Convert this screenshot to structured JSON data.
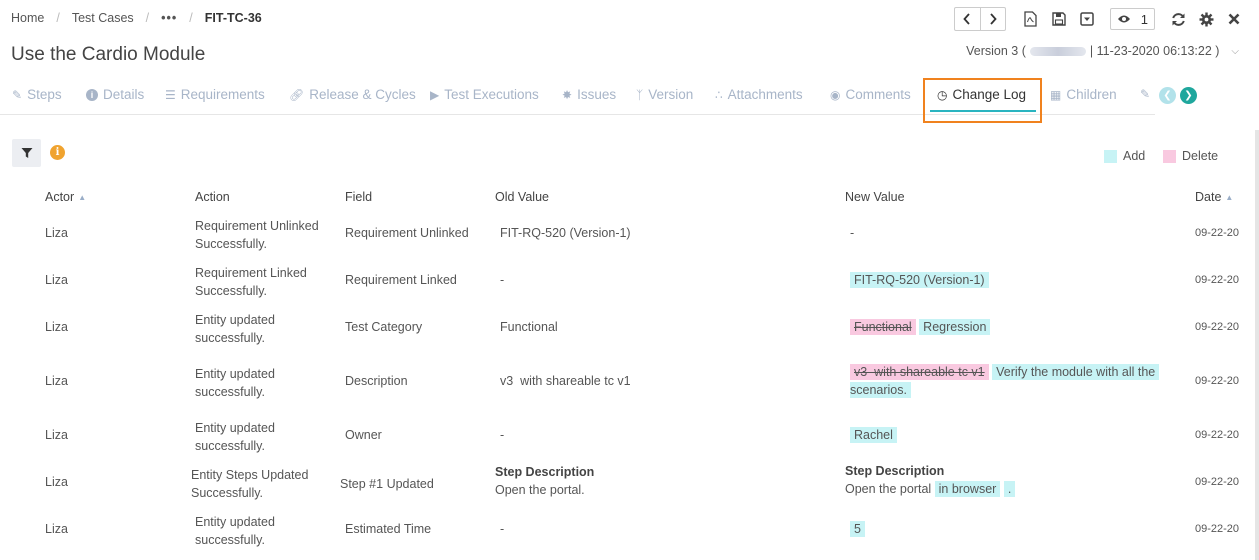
{
  "breadcrumb": {
    "home": "Home",
    "test_cases": "Test Cases",
    "more": "•••",
    "current": "FIT-TC-36"
  },
  "title": "Use the Cardio Module",
  "toolbar": {
    "watch_count": "1"
  },
  "version": {
    "prefix": "Version 3 (",
    "suffix": "| 11-23-2020 06:13:22 )"
  },
  "tabs": [
    {
      "label": "Steps",
      "icon": "edit-icon"
    },
    {
      "label": "Details",
      "icon": "info-icon"
    },
    {
      "label": "Requirements",
      "icon": "list-icon"
    },
    {
      "label": "Release & Cycles",
      "icon": "link-icon"
    },
    {
      "label": "Test Executions",
      "icon": "play-icon"
    },
    {
      "label": "Issues",
      "icon": "bug-icon"
    },
    {
      "label": "Version",
      "icon": "branch-icon"
    },
    {
      "label": "Attachments",
      "icon": "paperclip-icon"
    },
    {
      "label": "Comments",
      "icon": "comments-icon"
    },
    {
      "label": "Change Log",
      "icon": "clock-icon"
    },
    {
      "label": "Children",
      "icon": "sitemap-icon"
    }
  ],
  "colors": {
    "accent": "#2ab4c0",
    "highlight_box": "#f0821e",
    "add": "#c7f3f5",
    "delete": "#f9c9e0"
  },
  "legend": {
    "add": "Add",
    "delete": "Delete"
  },
  "table": {
    "headers": {
      "actor": "Actor",
      "action": "Action",
      "field": "Field",
      "old": "Old Value",
      "new": "New Value",
      "date": "Date"
    },
    "rows": [
      {
        "actor": "Liza",
        "action1": "Requirement Unlinked",
        "action2": "Successfully.",
        "field": "Requirement Unlinked",
        "old": "FIT-RQ-520 (Version-1)",
        "new": "-",
        "date": "09-22-20"
      },
      {
        "actor": "Liza",
        "action1": "Requirement Linked",
        "action2": "Successfully.",
        "field": "Requirement Linked",
        "old": "-",
        "new_add": "FIT-RQ-520 (Version-1)",
        "date": "09-22-20"
      },
      {
        "actor": "Liza",
        "action1": "Entity updated",
        "action2": "successfully.",
        "field": "Test Category",
        "old": "Functional",
        "new_del": "Functional",
        "new_add": "Regression",
        "date": "09-22-20"
      },
      {
        "actor": "Liza",
        "action1": "Entity updated",
        "action2": "successfully.",
        "field": "Description",
        "old": "v3  with shareable tc v1",
        "new_del": "v3  with shareable tc v1",
        "new_add1": "Verify the module with all the",
        "new_add2": "scenarios.",
        "date": "09-22-20"
      },
      {
        "actor": "Liza",
        "action1": "Entity updated",
        "action2": "successfully.",
        "field": "Owner",
        "old": "-",
        "new_add": "Rachel",
        "date": "09-22-20"
      },
      {
        "actor": "Liza",
        "action1": "Entity Steps Updated",
        "action2": "Successfully.",
        "field": "Step #1 Updated",
        "old_heading": "Step Description",
        "old": "Open the portal.",
        "new_heading": "Step Description",
        "new_plain": "Open the portal",
        "new_add": "in browser",
        "new_tail": ".",
        "date": "09-22-20"
      },
      {
        "actor": "Liza",
        "action1": "Entity updated",
        "action2": "successfully.",
        "field": "Estimated Time",
        "old": "-",
        "new_add": "5",
        "date": "09-22-20"
      }
    ]
  }
}
